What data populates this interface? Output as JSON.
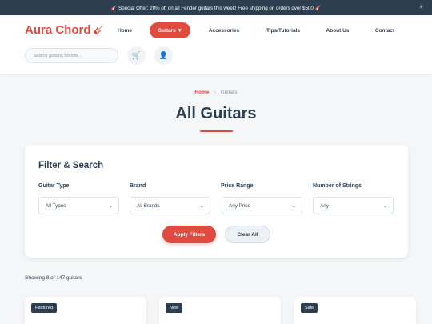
{
  "promo": {
    "text": "🎸 Special Offer: 20% off on all Fender guitars this week! Free shipping on orders over $500 🎸",
    "close_label": "×"
  },
  "header": {
    "logo_text": "Aura Chord",
    "logo_icon": "🎸",
    "nav": [
      {
        "label": "Home"
      },
      {
        "label": "Guitars ▼"
      },
      {
        "label": "Accessories"
      },
      {
        "label": "Tips/Tutorials"
      },
      {
        "label": "About Us"
      },
      {
        "label": "Contact"
      }
    ],
    "active_nav": "Guitars",
    "search": {
      "placeholder": "Search guitars, brands...",
      "value": ""
    },
    "cart_icon": "🛒",
    "account_icon": "👤"
  },
  "breadcrumb": {
    "home": "Home",
    "separator": "›",
    "current": "Guitars"
  },
  "page": {
    "title": "All Guitars"
  },
  "filters": {
    "title": "Filter & Search",
    "fields": [
      {
        "label": "Guitar Type",
        "value": "All Types"
      },
      {
        "label": "Brand",
        "value": "All Brands"
      },
      {
        "label": "Price Range",
        "value": "Any Price"
      },
      {
        "label": "Number of Strings",
        "value": "Any"
      }
    ],
    "apply_label": "Apply Filters",
    "clear_label": "Clear All"
  },
  "results": {
    "count_text": "Showing 8 of 147 guitars"
  },
  "products": [
    {
      "badge": "Featured"
    },
    {
      "badge": "New"
    },
    {
      "badge": "Sale"
    }
  ],
  "colors": {
    "accent": "#e04a3f",
    "dark": "#2c3e50",
    "background": "#f5f6f7"
  }
}
